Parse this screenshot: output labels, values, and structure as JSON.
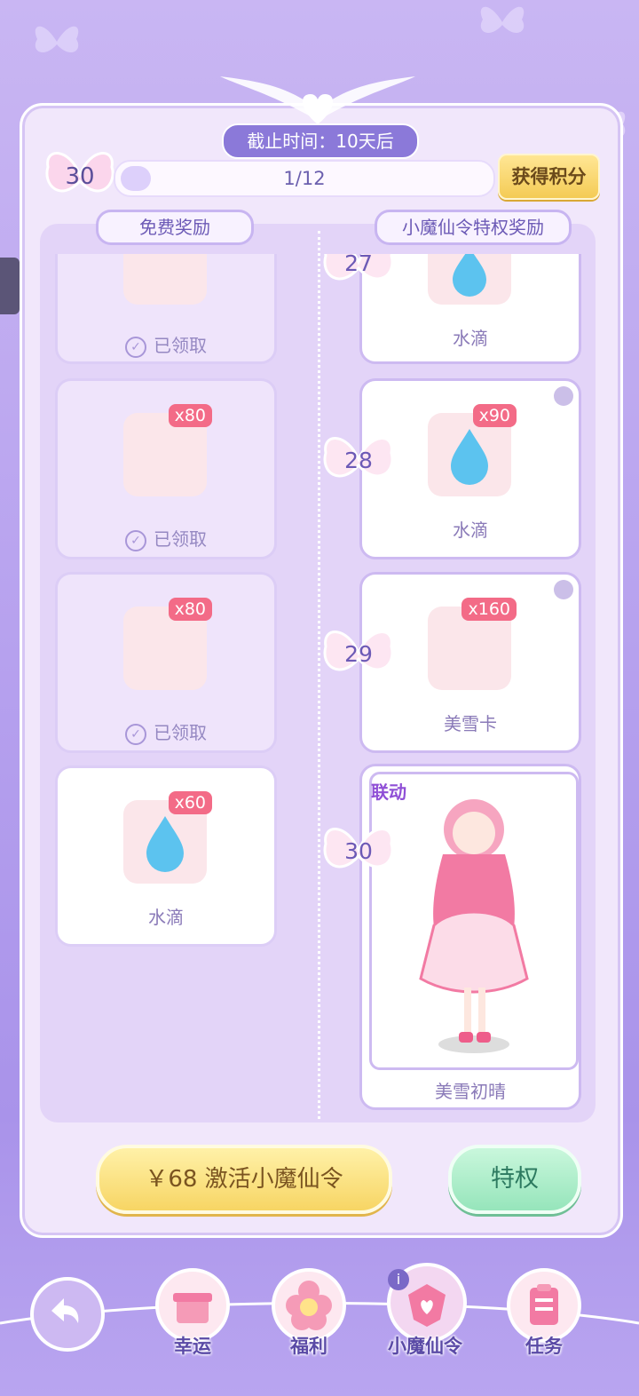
{
  "header": {
    "deadline": "截止时间：10天后",
    "level": "30",
    "progress_text": "1/12",
    "progress_fraction": 0.083,
    "earn_points_label": "获得积分"
  },
  "tabs": {
    "free": "免费奖励",
    "premium": "小魔仙令特权奖励"
  },
  "rows": [
    {
      "level": "27",
      "free": {
        "qty": "",
        "name": "",
        "status": "已领取"
      },
      "premium": {
        "qty": "",
        "name": "水滴"
      }
    },
    {
      "level": "28",
      "free": {
        "qty": "x80",
        "name": "",
        "status": "已领取"
      },
      "premium": {
        "qty": "x90",
        "name": "水滴"
      }
    },
    {
      "level": "29",
      "free": {
        "qty": "x80",
        "name": "",
        "status": "已领取"
      },
      "premium": {
        "qty": "x160",
        "name": "美雪卡"
      }
    },
    {
      "level": "30",
      "free": {
        "qty": "x60",
        "name": "水滴",
        "status": ""
      },
      "premium": {
        "qty": "",
        "name": "美雪初晴",
        "tag": "联动"
      }
    }
  ],
  "actions": {
    "activate": "￥68 激活小魔仙令",
    "privilege": "特权"
  },
  "nav": {
    "items": [
      {
        "label": "幸运",
        "icon": "gift-icon"
      },
      {
        "label": "福利",
        "icon": "flower-icon"
      },
      {
        "label": "小魔仙令",
        "icon": "pass-icon"
      },
      {
        "label": "任务",
        "icon": "clipboard-icon"
      }
    ]
  },
  "colors": {
    "accent": "#8b79d9",
    "badge": "#f36b87",
    "gold": "#f4cb55",
    "mint": "#96e5bb"
  }
}
